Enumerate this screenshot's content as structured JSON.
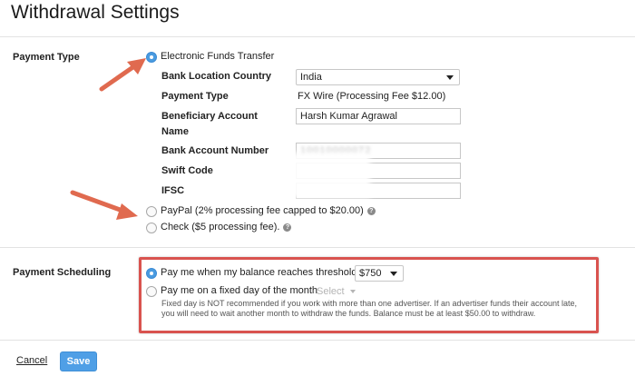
{
  "page": {
    "title": "Withdrawal Settings"
  },
  "payment_type": {
    "label": "Payment Type",
    "options": [
      {
        "label": "Electronic Funds Transfer",
        "selected": true
      },
      {
        "label": "PayPal (2% processing fee capped to $20.00)",
        "selected": false
      },
      {
        "label": "Check ($5 processing fee).",
        "selected": false
      }
    ],
    "eft": {
      "bank_location_label": "Bank Location Country",
      "bank_location_value": "India",
      "payment_type_label": "Payment Type",
      "payment_type_value": "FX Wire (Processing Fee $12.00)",
      "beneficiary_label_line1": "Beneficiary Account",
      "beneficiary_label_line2": "Name",
      "beneficiary_value": "Harsh Kumar Agrawal",
      "account_number_label": "Bank Account Number",
      "account_number_value": "10010000072",
      "swift_label": "Swift Code",
      "ifsc_label": "IFSC"
    }
  },
  "payment_scheduling": {
    "label": "Payment Scheduling",
    "threshold_option": "Pay me when my balance reaches threshold",
    "threshold_value": "$750",
    "fixed_day_option": "Pay me on a fixed day of the month",
    "fixed_day_placeholder": "Select",
    "note": "Fixed day is NOT recommended if you work with more than one advertiser. If an advertiser funds their account late, you will need to wait another month to withdraw the funds. Balance must be at least $50.00 to withdraw."
  },
  "actions": {
    "cancel": "Cancel",
    "save": "Save"
  },
  "colors": {
    "accent": "#4f9fe6",
    "annotation": "#d9534f",
    "arrow": "#e06a4f"
  },
  "icons": {
    "help": "question-circle-icon"
  }
}
